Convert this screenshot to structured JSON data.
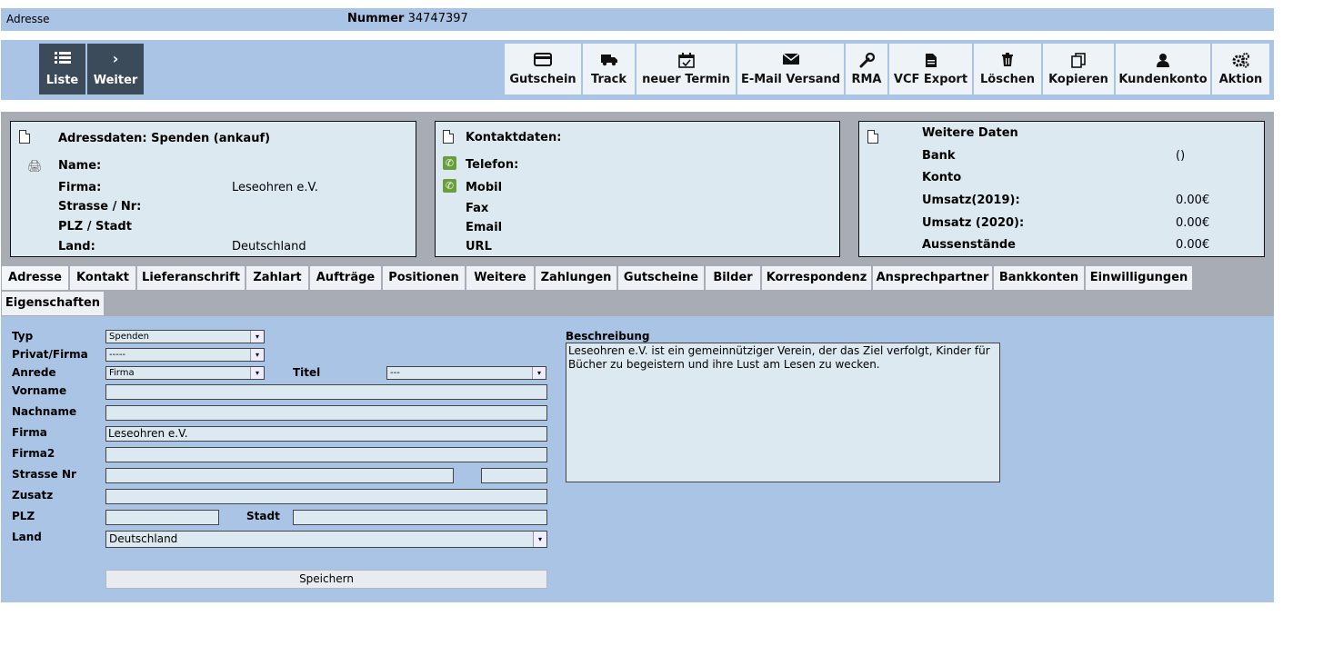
{
  "header": {
    "section_label": "Adresse",
    "number_label": "Nummer",
    "number_value": "34747397"
  },
  "nav": {
    "list_label": "Liste",
    "next_label": "Weiter"
  },
  "toolbar": [
    {
      "label": "Gutschein",
      "icon": "credit-card-icon"
    },
    {
      "label": "Track",
      "icon": "truck-icon"
    },
    {
      "label": "neuer Termin",
      "icon": "calendar-icon"
    },
    {
      "label": "E-Mail Versand",
      "icon": "envelope-icon"
    },
    {
      "label": "RMA",
      "icon": "wrench-icon"
    },
    {
      "label": "VCF Export",
      "icon": "document-icon"
    },
    {
      "label": "Löschen",
      "icon": "trash-icon"
    },
    {
      "label": "Kopieren",
      "icon": "copy-icon"
    },
    {
      "label": "Kundenkonto",
      "icon": "user-icon"
    },
    {
      "label": "Aktion",
      "icon": "gears-icon"
    }
  ],
  "address_card": {
    "title": "Adressdaten: Spenden (ankauf)",
    "name_label": "Name:",
    "firma_label": "Firma:",
    "firma_value": "Leseohren e.V.",
    "street_label": "Strasse / Nr:",
    "plz_label": "PLZ / Stadt",
    "land_label": "Land:",
    "land_value": "Deutschland"
  },
  "contact_card": {
    "title": "Kontaktdaten:",
    "telefon_label": "Telefon:",
    "mobil_label": "Mobil",
    "fax_label": "Fax",
    "email_label": "Email",
    "url_label": "URL"
  },
  "more_card": {
    "title": "Weitere Daten",
    "bank_label": "Bank",
    "bank_value": "()",
    "konto_label": "Konto",
    "umsatz2019_label": "Umsatz(2019):",
    "umsatz2019_value": "0.00€",
    "umsatz2020_label": "Umsatz (2020):",
    "umsatz2020_value": "0.00€",
    "aussen_label": "Aussenstände",
    "aussen_value": "0.00€"
  },
  "tabs": [
    "Adresse",
    "Kontakt",
    "Lieferanschrift",
    "Zahlart",
    "Aufträge",
    "Positionen",
    "Weitere",
    "Zahlungen",
    "Gutscheine",
    "Bilder",
    "Korrespondenz",
    "Ansprechpartner",
    "Bankkonten",
    "Einwilligungen",
    "Eigenschaften"
  ],
  "form": {
    "typ_label": "Typ",
    "typ_value": "Spenden",
    "privat_label": "Privat/Firma",
    "privat_value": "-----",
    "anrede_label": "Anrede",
    "anrede_value": "Firma",
    "titel_label": "Titel",
    "titel_value": "---",
    "vorname_label": "Vorname",
    "vorname_value": "",
    "nachname_label": "Nachname",
    "nachname_value": "",
    "firma_label": "Firma",
    "firma_value": "Leseohren e.V.",
    "firma2_label": "Firma2",
    "firma2_value": "",
    "strasse_label": "Strasse Nr",
    "strasse_value": "",
    "nr_value": "",
    "zusatz_label": "Zusatz",
    "zusatz_value": "",
    "plz_label": "PLZ",
    "plz_value": "",
    "stadt_label": "Stadt",
    "stadt_value": "",
    "land_label": "Land",
    "land_value": "Deutschland",
    "beschreibung_label": "Beschreibung",
    "beschreibung_value": "Leseohren e.V. ist ein gemeinnütziger Verein, der das Ziel verfolgt, Kinder für Bücher zu begeistern und ihre Lust am Lesen zu wecken.",
    "save_label": "Speichern"
  }
}
